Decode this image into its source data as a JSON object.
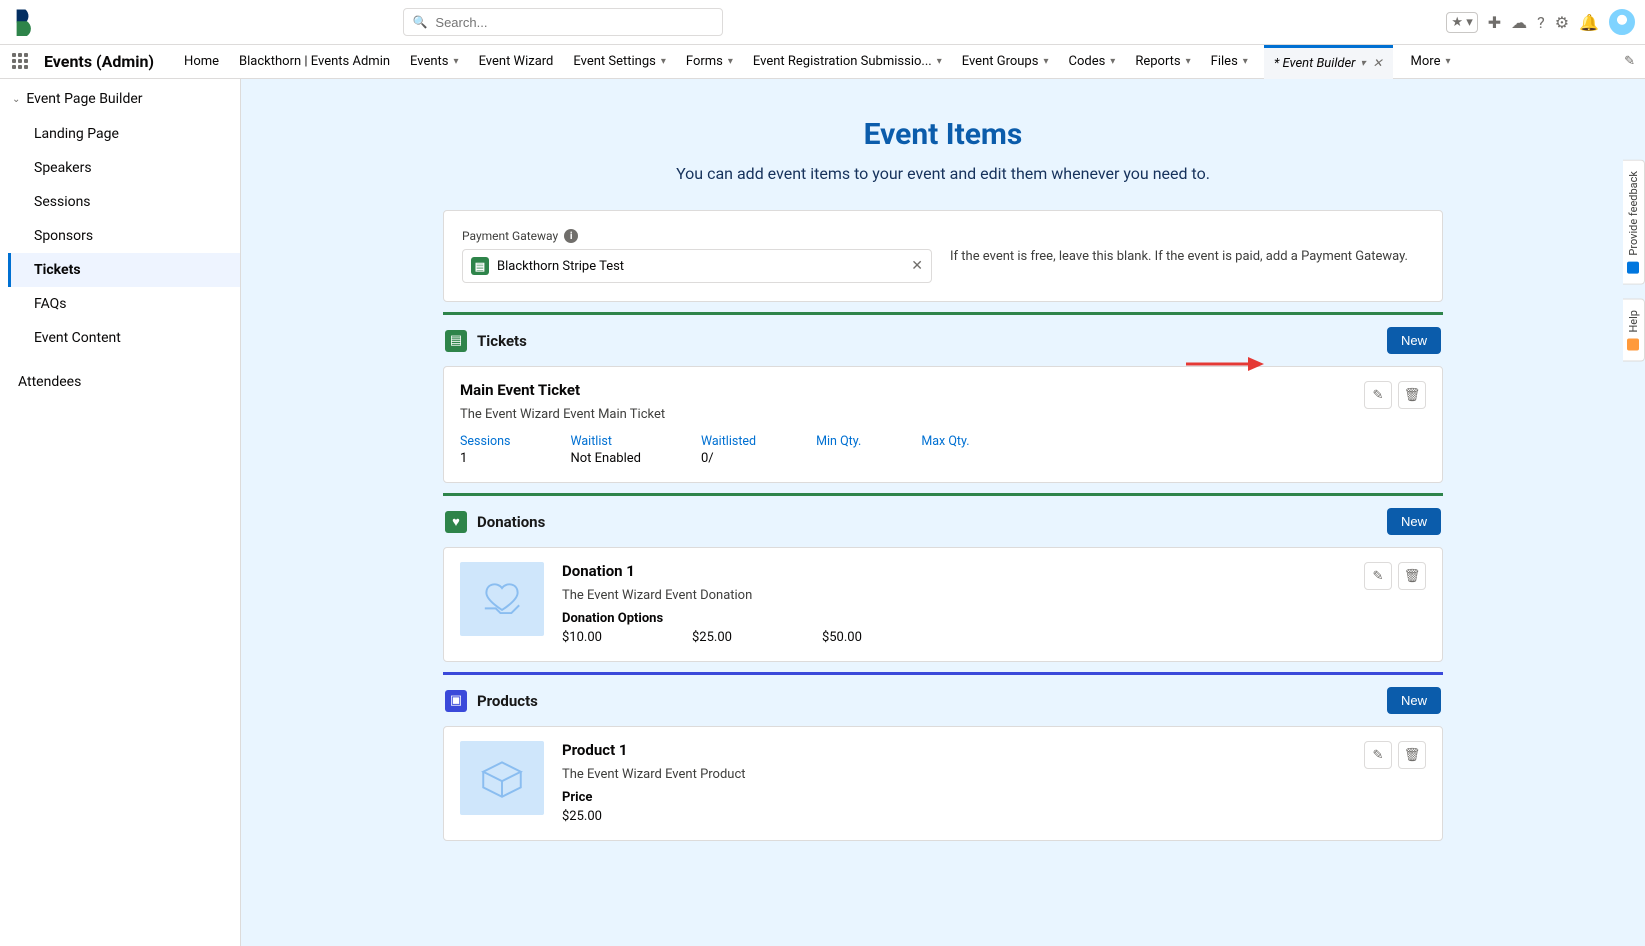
{
  "header": {
    "search_placeholder": "Search..."
  },
  "nav": {
    "app_title": "Events (Admin)",
    "items": [
      {
        "label": "Home",
        "dd": false
      },
      {
        "label": "Blackthorn | Events Admin",
        "dd": false
      },
      {
        "label": "Events",
        "dd": true
      },
      {
        "label": "Event Wizard",
        "dd": false
      },
      {
        "label": "Event Settings",
        "dd": true
      },
      {
        "label": "Forms",
        "dd": true
      },
      {
        "label": "Event Registration Submissio...",
        "dd": true
      },
      {
        "label": "Event Groups",
        "dd": true
      },
      {
        "label": "Codes",
        "dd": true
      },
      {
        "label": "Reports",
        "dd": true
      },
      {
        "label": "Files",
        "dd": true
      }
    ],
    "active_tab": "* Event Builder",
    "more_label": "More"
  },
  "sidebar": {
    "header": "Event Page Builder",
    "items": [
      "Landing Page",
      "Speakers",
      "Sessions",
      "Sponsors",
      "Tickets",
      "FAQs",
      "Event Content"
    ],
    "active": "Tickets",
    "attendees": "Attendees"
  },
  "page": {
    "title": "Event Items",
    "subtitle": "You can add event items to your event and edit them whenever you need to."
  },
  "gateway": {
    "label": "Payment Gateway",
    "value": "Blackthorn Stripe Test",
    "hint": "If the event is free, leave this blank. If the event is paid, add a Payment Gateway."
  },
  "tickets": {
    "title": "Tickets",
    "new_label": "New",
    "item": {
      "name": "Main Event Ticket",
      "desc": "The Event Wizard Event Main Ticket",
      "stats": [
        {
          "label": "Sessions",
          "value": "1"
        },
        {
          "label": "Waitlist",
          "value": "Not Enabled"
        },
        {
          "label": "Waitlisted",
          "value": "0/"
        },
        {
          "label": "Min Qty.",
          "value": ""
        },
        {
          "label": "Max Qty.",
          "value": ""
        }
      ]
    }
  },
  "donations": {
    "title": "Donations",
    "new_label": "New",
    "item": {
      "name": "Donation 1",
      "desc": "The Event Wizard Event Donation",
      "options_label": "Donation Options",
      "options": [
        "$10.00",
        "$25.00",
        "$50.00"
      ]
    }
  },
  "products": {
    "title": "Products",
    "new_label": "New",
    "item": {
      "name": "Product 1",
      "desc": "The Event Wizard Event Product",
      "price_label": "Price",
      "price": "$25.00"
    }
  },
  "feedback": {
    "provide": "Provide feedback",
    "help": "Help"
  }
}
